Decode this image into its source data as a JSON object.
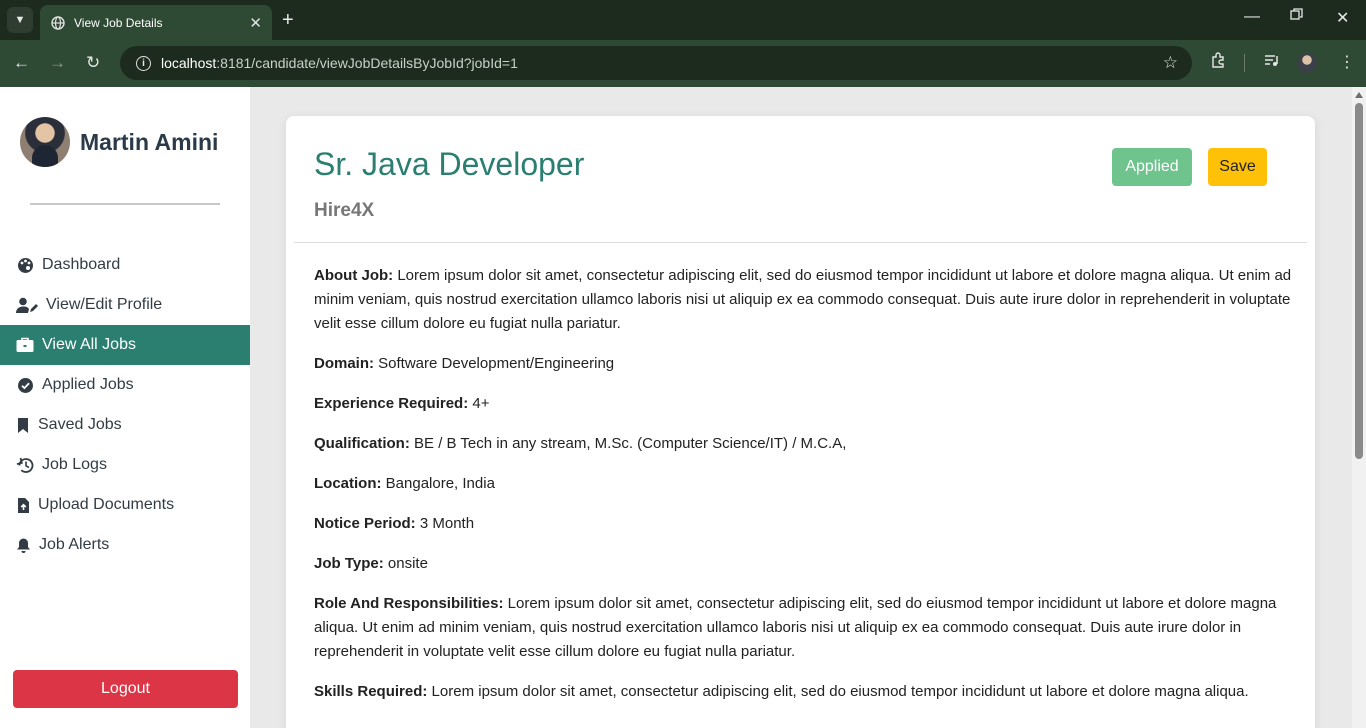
{
  "browser": {
    "tab_title": "View Job Details",
    "tab_close": "✕",
    "new_tab": "+",
    "url_host": "localhost",
    "url_path": ":8181/candidate/viewJobDetailsByJobId?jobId=1"
  },
  "sidebar": {
    "user_name": "Martin Amini",
    "items": [
      {
        "label": "Dashboard",
        "icon": "palette-icon"
      },
      {
        "label": "View/Edit Profile",
        "icon": "user-edit-icon"
      },
      {
        "label": "View All Jobs",
        "icon": "briefcase-icon"
      },
      {
        "label": "Applied Jobs",
        "icon": "check-circle-icon"
      },
      {
        "label": "Saved Jobs",
        "icon": "bookmark-icon"
      },
      {
        "label": "Job Logs",
        "icon": "history-icon"
      },
      {
        "label": "Upload Documents",
        "icon": "file-upload-icon"
      },
      {
        "label": "Job Alerts",
        "icon": "bell-icon"
      }
    ],
    "active_index": 2,
    "logout_label": "Logout"
  },
  "job": {
    "title": "Sr. Java Developer",
    "company": "Hire4X",
    "applied_label": "Applied",
    "save_label": "Save",
    "details": [
      {
        "label": "About Job:",
        "value": "Lorem ipsum dolor sit amet, consectetur adipiscing elit, sed do eiusmod tempor incididunt ut labore et dolore magna aliqua. Ut enim ad minim veniam, quis nostrud exercitation ullamco laboris nisi ut aliquip ex ea commodo consequat. Duis aute irure dolor in reprehenderit in voluptate velit esse cillum dolore eu fugiat nulla pariatur."
      },
      {
        "label": "Domain:",
        "value": "Software Development/Engineering"
      },
      {
        "label": "Experience Required:",
        "value": "4+"
      },
      {
        "label": "Qualification:",
        "value": "BE / B Tech in any stream, M.Sc. (Computer Science/IT) / M.C.A,"
      },
      {
        "label": "Location:",
        "value": "Bangalore, India"
      },
      {
        "label": "Notice Period:",
        "value": "3 Month"
      },
      {
        "label": "Job Type:",
        "value": "onsite"
      },
      {
        "label": "Role And Responsibilities:",
        "value": "Lorem ipsum dolor sit amet, consectetur adipiscing elit, sed do eiusmod tempor incididunt ut labore et dolore magna aliqua. Ut enim ad minim veniam, quis nostrud exercitation ullamco laboris nisi ut aliquip ex ea commodo consequat. Duis aute irure dolor in reprehenderit in voluptate velit esse cillum dolore eu fugiat nulla pariatur."
      },
      {
        "label": "Skills Required:",
        "value": "Lorem ipsum dolor sit amet, consectetur adipiscing elit, sed do eiusmod tempor incididunt ut labore et dolore magna aliqua."
      }
    ]
  },
  "colors": {
    "accent": "#2a7f70",
    "applied": "#6fc38d",
    "save": "#ffc107",
    "logout": "#dc3545"
  }
}
